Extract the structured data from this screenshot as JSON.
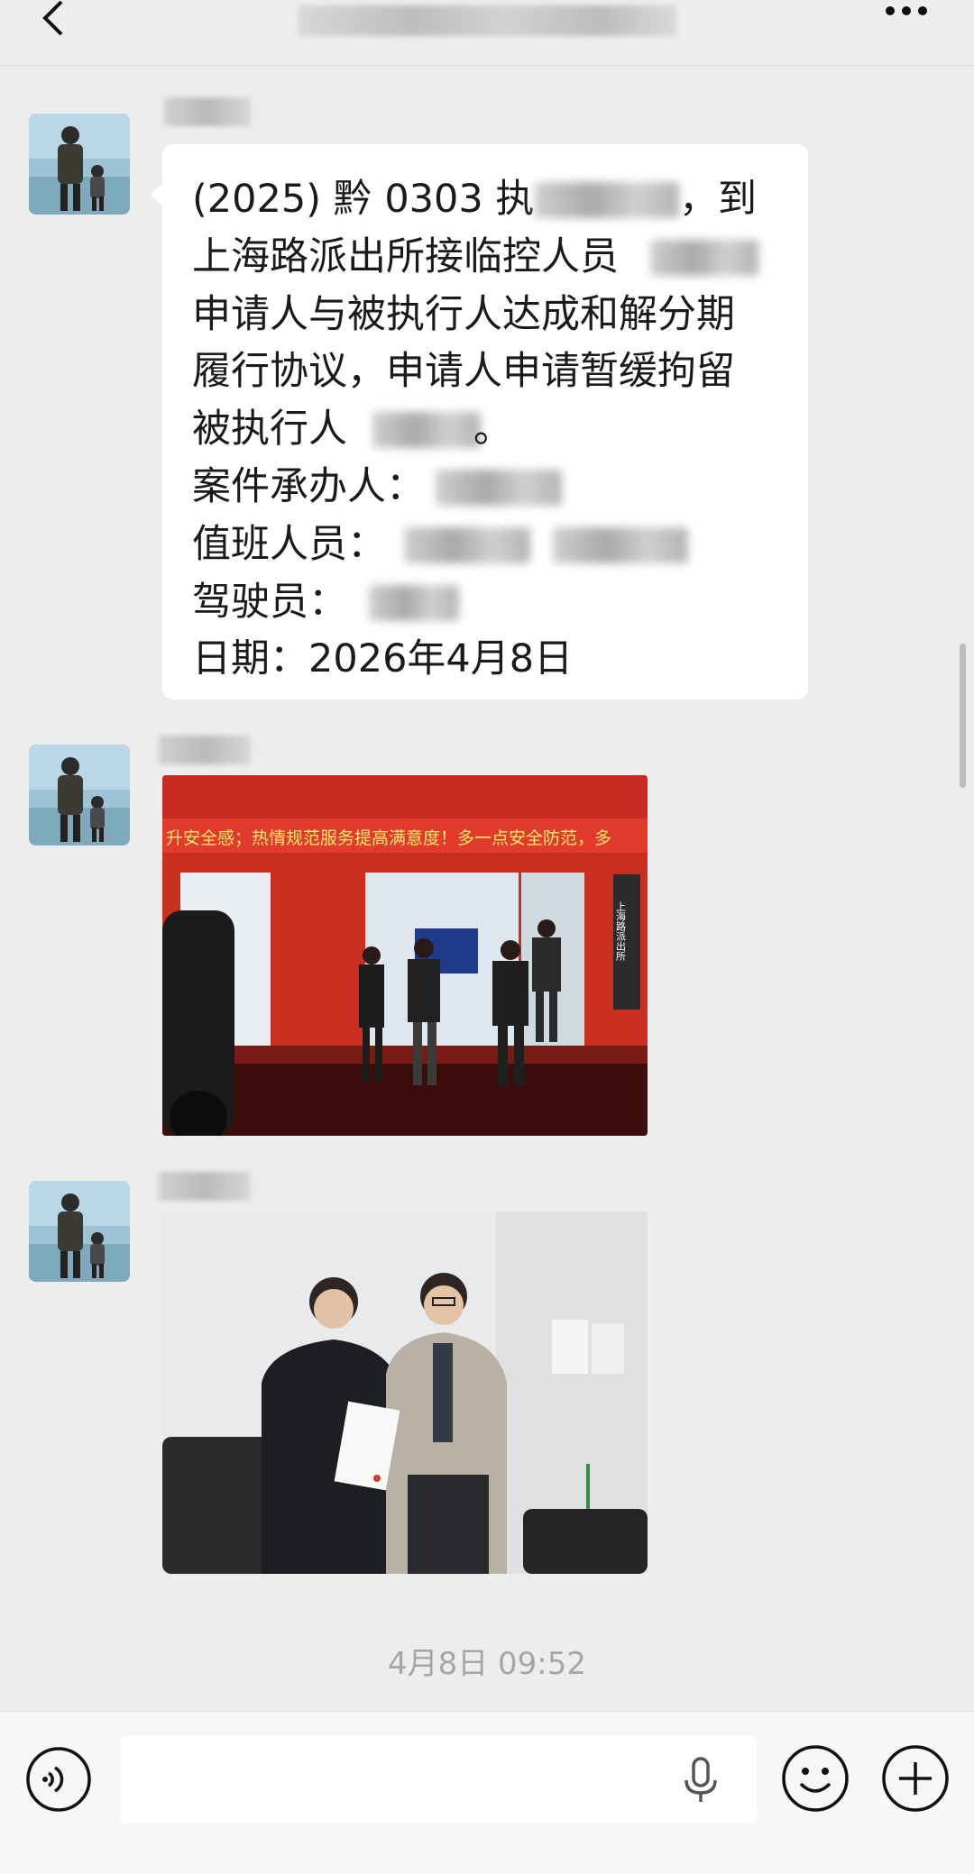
{
  "header": {
    "back_icon": "chevron-left-icon",
    "more_icon": "more-dots-icon"
  },
  "messages": [
    {
      "type": "text",
      "lines": [
        "(2025) 黔 0303 执",
        "上海路派出所接临控人员",
        "申请人与被执行人达成和解分期",
        "履行协议，申请人申请暂缓拘留",
        "被执行人",
        "案件承办人：",
        "值班人员：",
        "驾驶员：",
        "日期：2026年4月8日"
      ],
      "line1_tail": "，到",
      "line5_tail": "。"
    },
    {
      "type": "image",
      "banner_text": "升安全感；热情规范服务提高满意度！多一点安全防范，多",
      "sign_text": "上海路派出所"
    },
    {
      "type": "image"
    }
  ],
  "timestamp": "4月8日 09:52",
  "input": {
    "placeholder": "",
    "voice_icon": "voice-mode-icon",
    "mic_icon": "microphone-icon",
    "emoji_icon": "emoji-icon",
    "plus_icon": "plus-icon"
  },
  "colors": {
    "background": "#ededed",
    "bubble": "#ffffff",
    "timestamp": "#a6a6a6",
    "photo_red": "#d42a22"
  }
}
